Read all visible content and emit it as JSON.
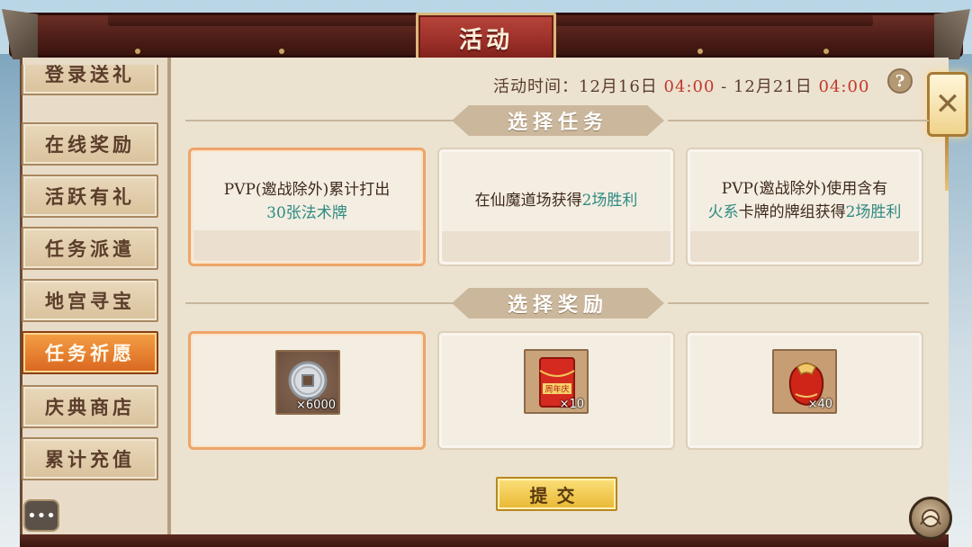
{
  "header": {
    "title": "活动"
  },
  "sidebar": {
    "items": [
      {
        "label": "登录送礼",
        "active": false
      },
      {
        "label": "在线奖励",
        "active": false
      },
      {
        "label": "活跃有礼",
        "active": false
      },
      {
        "label": "任务派遣",
        "active": false
      },
      {
        "label": "地宫寻宝",
        "active": false
      },
      {
        "label": "任务祈愿",
        "active": true
      },
      {
        "label": "庆典商店",
        "active": false
      },
      {
        "label": "累计充值",
        "active": false
      }
    ]
  },
  "activity_time": {
    "label": "活动时间：",
    "start_date": "12月16日",
    "start_time": "04:00",
    "separator": "-",
    "end_date": "12月21日",
    "end_time": "04:00"
  },
  "help_label": "?",
  "sections": {
    "tasks_title": "选择任务",
    "rewards_title": "选择奖励"
  },
  "tasks": [
    {
      "prefix": "PVP(邀战除外)累计打出",
      "highlight": "30张法术牌",
      "suffix": "",
      "selected": true
    },
    {
      "prefix": "在仙魔道场获得",
      "highlight": "2场胜利",
      "suffix": "",
      "selected": false
    },
    {
      "prefix": "PVP(邀战除外)使用含有",
      "highlight": "火系",
      "middle": "卡牌的牌组获得",
      "highlight2": "2场胜利",
      "selected": false
    }
  ],
  "rewards": [
    {
      "icon": "silver-coin-icon",
      "qty": "×6000",
      "selected": true
    },
    {
      "icon": "red-envelope-icon",
      "badge": "周年庆",
      "qty": "×10",
      "selected": false
    },
    {
      "icon": "red-pouch-icon",
      "qty": "×40",
      "selected": false
    }
  ],
  "submit_label": "提交",
  "colors": {
    "highlight": "#2e8b82",
    "time_red": "#c0392b",
    "active_tab": "#e57d2c",
    "selected_border": "#eea56a"
  }
}
